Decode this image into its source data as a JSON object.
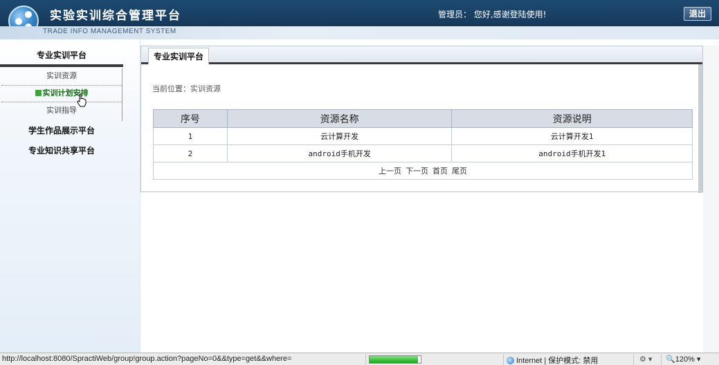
{
  "header": {
    "title": "实验实训综合管理平台",
    "subtitle": "TRADE INFO MANAGEMENT SYSTEM",
    "welcome": "管理员：  您好,感谢登陆使用!",
    "logout_label": "退出"
  },
  "sidebar": {
    "sections": [
      {
        "label": "专业实训平台"
      },
      {
        "label": "学生作品展示平台"
      },
      {
        "label": "专业知识共享平台"
      }
    ],
    "sub_items": [
      {
        "label": "实训资源"
      },
      {
        "label": "实训计划安排"
      },
      {
        "label": "实训指导"
      }
    ]
  },
  "main": {
    "tab_label": "专业实训平台",
    "breadcrumb": "当前位置：实训资源",
    "table": {
      "columns": [
        "序号",
        "资源名称",
        "资源说明"
      ],
      "rows": [
        [
          "1",
          "云计算开发",
          "云计算开发1"
        ],
        [
          "2",
          "android手机开发",
          "android手机开发1"
        ]
      ]
    },
    "pager": {
      "prev": "上一页",
      "next": "下一页",
      "first": "首页",
      "last": "尾页"
    }
  },
  "statusbar": {
    "url": "http://localhost:8080/SpractiWeb/group!group.action?pageNo=0&&type=get&&where=",
    "zone": "Internet | 保护模式: 禁用",
    "zoom": "120%",
    "progress": 0.95
  },
  "colors": {
    "header_bg": "#173a5c",
    "active_item": "#146b14",
    "progress_fill": "#1aa51a"
  }
}
